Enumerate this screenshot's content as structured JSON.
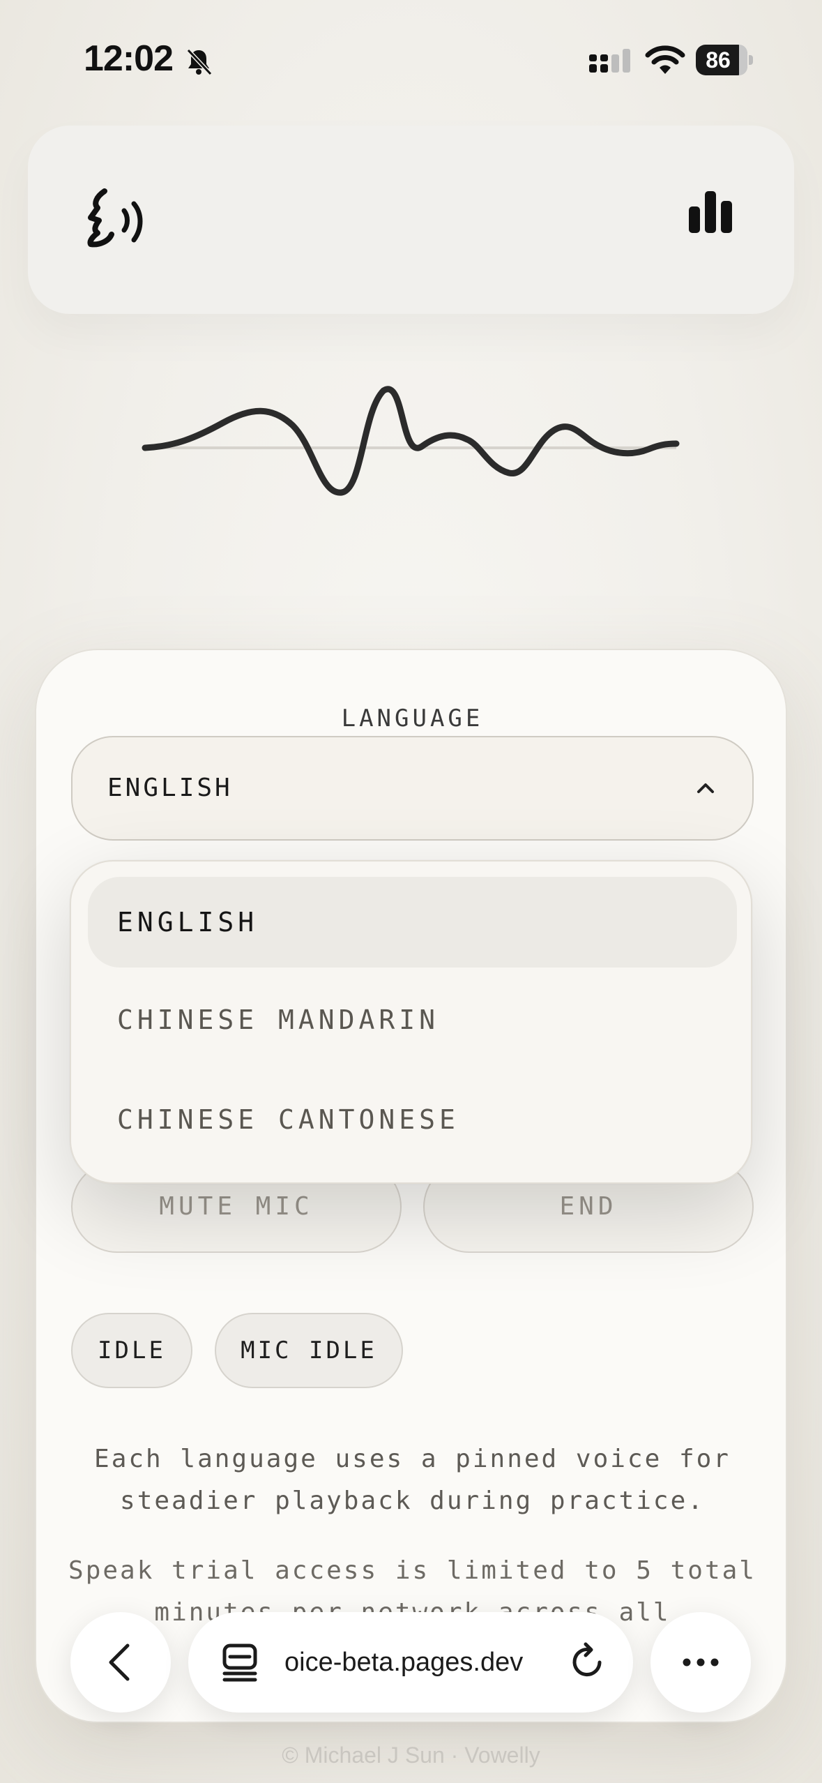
{
  "status_bar": {
    "time": "12:02",
    "battery": "86",
    "icons": [
      "bell-slash-icon",
      "signal-icon",
      "wifi-icon",
      "battery-icon"
    ]
  },
  "header": {
    "icons": [
      "speaking-head-icon",
      "bar-chart-icon"
    ]
  },
  "language": {
    "heading": "LANGUAGE",
    "selected": "ENGLISH",
    "options": [
      "ENGLISH",
      "CHINESE MANDARIN",
      "CHINESE CANTONESE"
    ]
  },
  "controls": {
    "mute_label": "MUTE MIC",
    "end_label": "END"
  },
  "status": {
    "session": "IDLE",
    "mic": "MIC IDLE"
  },
  "notes": {
    "voice": "Each language uses a pinned voice for steadier playback during practice.",
    "trial": "Speak trial access is limited to 5 total minutes per network across all"
  },
  "browser": {
    "url": "oice-beta.pages.dev",
    "icons": [
      "back-icon",
      "tabs-icon",
      "reload-icon",
      "more-icon"
    ]
  },
  "footer": {
    "text": "© Michael J Sun · Vowelly"
  },
  "colors": {
    "background": "#f1efea",
    "card": "#fbfaf7",
    "ink": "#1c1c1c",
    "muted": "#9a958d"
  }
}
